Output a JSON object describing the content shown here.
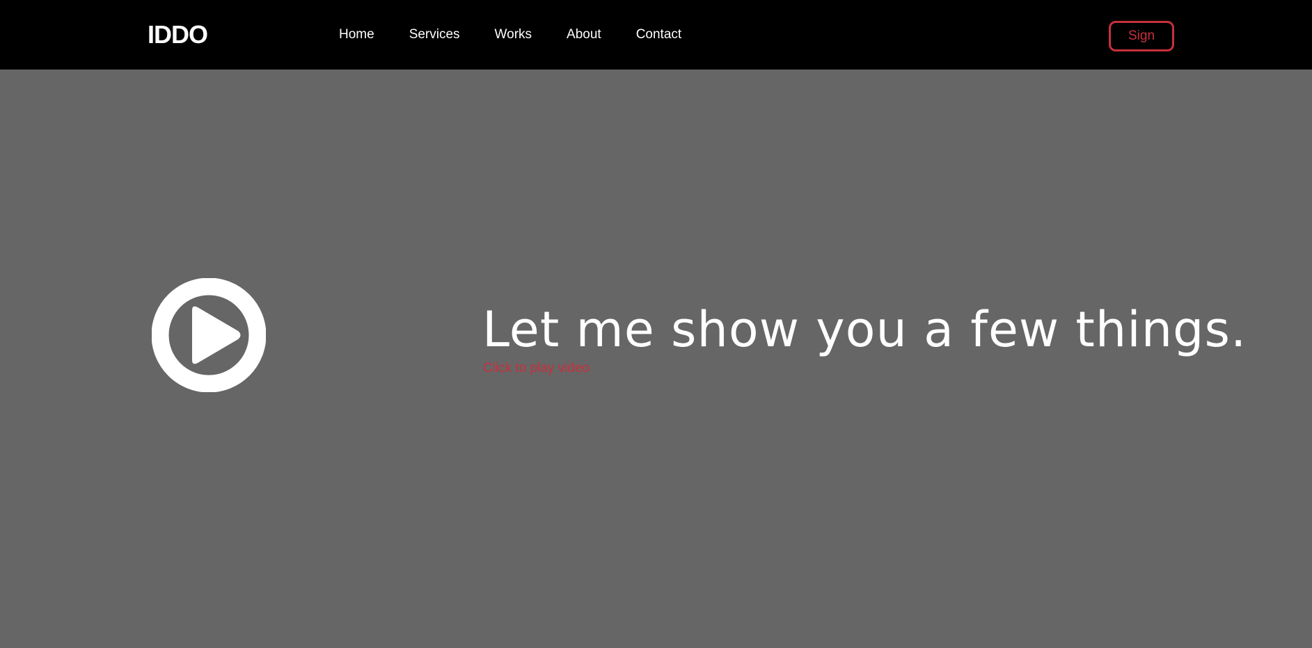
{
  "header": {
    "logo": "IDDO",
    "nav": [
      {
        "label": "Home"
      },
      {
        "label": "Services"
      },
      {
        "label": "Works"
      },
      {
        "label": "About"
      },
      {
        "label": "Contact"
      }
    ],
    "sign_label": "Sign"
  },
  "hero": {
    "play_icon": "play-circle-icon",
    "headline": "Let me show you a few things.",
    "play_link": "Click to play video"
  },
  "colors": {
    "nav_background": "#000000",
    "hero_background": "#666666",
    "accent": "#c8303c",
    "text": "#ffffff"
  }
}
